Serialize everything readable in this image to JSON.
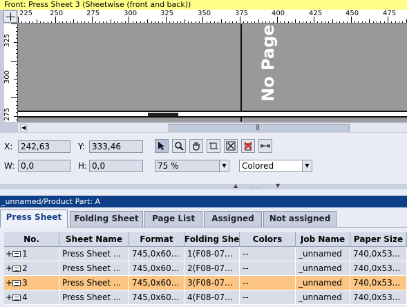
{
  "title": "Front:  Press Sheet 3 (Sheetwise (front and back))",
  "ruler": {
    "top": [
      "225",
      "250",
      "275",
      "300",
      "325",
      "350",
      "375",
      "400",
      "425",
      "450",
      "475"
    ],
    "left": [
      "325",
      "300",
      "275"
    ]
  },
  "canvas": {
    "overlay_text": "No Page"
  },
  "info": {
    "x_label": "X:",
    "x_value": "242,63",
    "y_label": "Y:",
    "y_value": "333,46",
    "w_label": "W:",
    "w_value": "0,0",
    "h_label": "H:",
    "h_value": "0,0",
    "zoom": "75 %",
    "color_mode": "Colored"
  },
  "tools": [
    "select-arrow-icon",
    "zoom-icon",
    "hand-icon",
    "crop-icon",
    "fit-icon",
    "delete-mark-icon",
    "measure-icon"
  ],
  "part_header": "_unnamed/Product Part: A",
  "tabs": [
    "Press Sheet",
    "Folding Sheet",
    "Page List",
    "Assigned",
    "Not assigned"
  ],
  "table": {
    "columns": [
      "No.",
      "Sheet Name",
      "Format",
      "Folding Sheet",
      "Colors",
      "Job Name",
      "Paper Size"
    ],
    "rows": [
      {
        "no": "1",
        "sheet_name": "Press Sheet ...",
        "format": "745,0x60...",
        "folding_sheet": "1(F08-07...",
        "colors": "--",
        "job_name": "_unnamed",
        "paper_size": "740,0x53..."
      },
      {
        "no": "2",
        "sheet_name": "Press Sheet ...",
        "format": "745,0x60...",
        "folding_sheet": "2(F08-07...",
        "colors": "--",
        "job_name": "_unnamed",
        "paper_size": "740,0x53..."
      },
      {
        "no": "3",
        "sheet_name": "Press Sheet ...",
        "format": "745,0x60...",
        "folding_sheet": "3(F08-07...",
        "colors": "--",
        "job_name": "_unnamed",
        "paper_size": "740,0x53..."
      },
      {
        "no": "4",
        "sheet_name": "Press Sheet ...",
        "format": "745,0x60...",
        "folding_sheet": "4(F08-07...",
        "colors": "--",
        "job_name": "_unnamed",
        "paper_size": "740,0x53..."
      }
    ],
    "selected_row": 2
  },
  "colors": {
    "title_bg": "#ffff88",
    "header_bg": "#0d3f86",
    "selected_row": "#fdc583",
    "canvas_gray": "#999999"
  }
}
